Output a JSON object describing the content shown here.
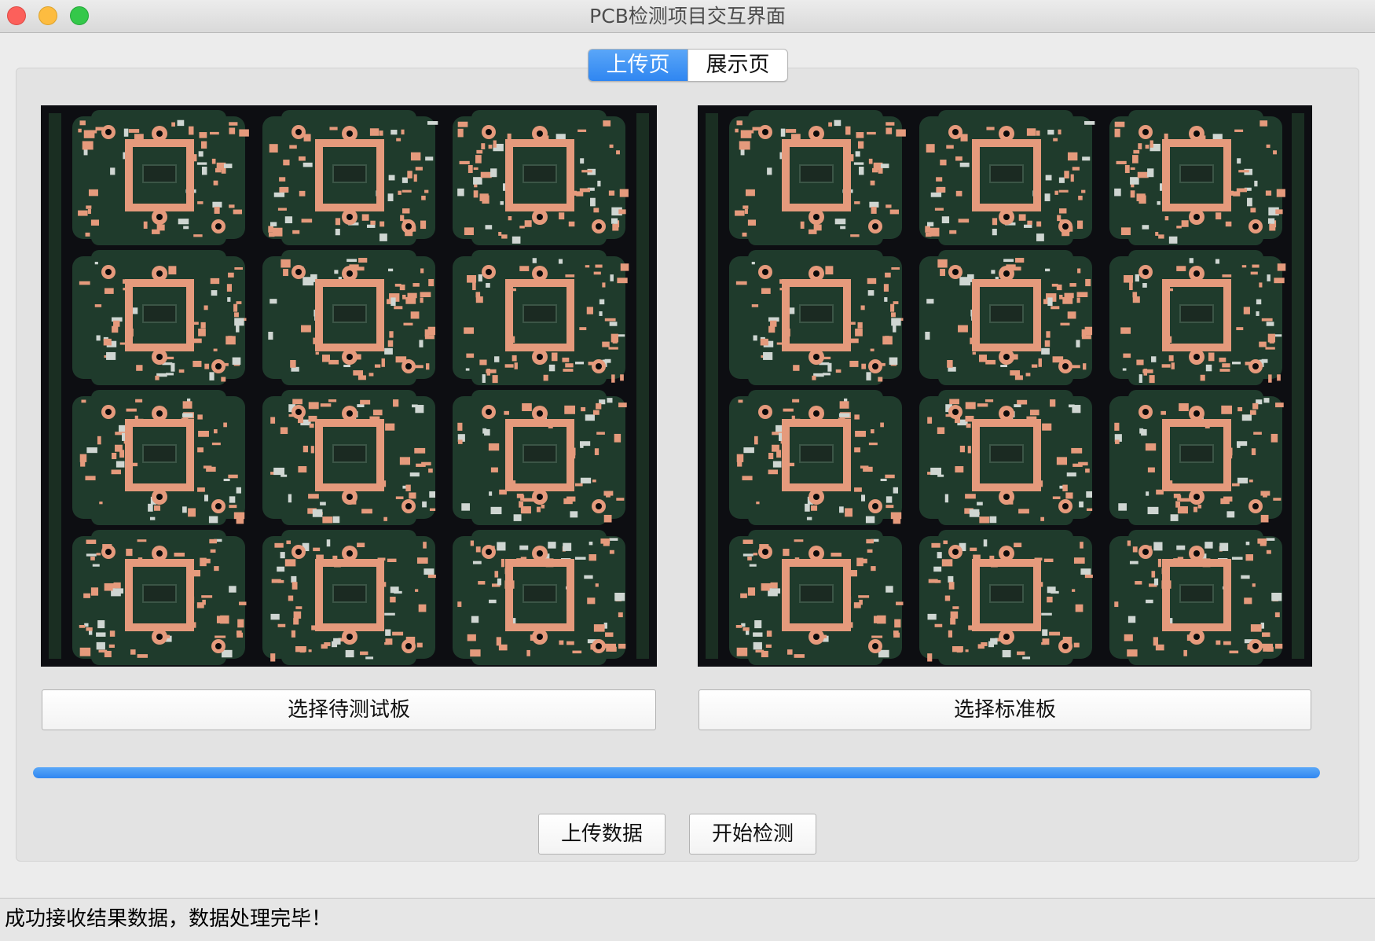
{
  "window": {
    "title": "PCB检测项目交互界面"
  },
  "tabs": [
    {
      "label": "上传页",
      "active": true
    },
    {
      "label": "展示页",
      "active": false
    }
  ],
  "images": {
    "test_board": "pcb-panel-image",
    "standard_board": "pcb-panel-image"
  },
  "buttons": {
    "select_test_board": "选择待测试板",
    "select_standard_board": "选择标准板",
    "upload_data": "上传数据",
    "start_detection": "开始检测"
  },
  "progress": {
    "value_percent": 100
  },
  "status": {
    "message": "成功接收结果数据，数据处理完毕！"
  },
  "colors": {
    "accent": "#2f86f1",
    "board_green": "#1f3b2c",
    "copper": "#e59a7c",
    "background": "#0d0e12"
  }
}
